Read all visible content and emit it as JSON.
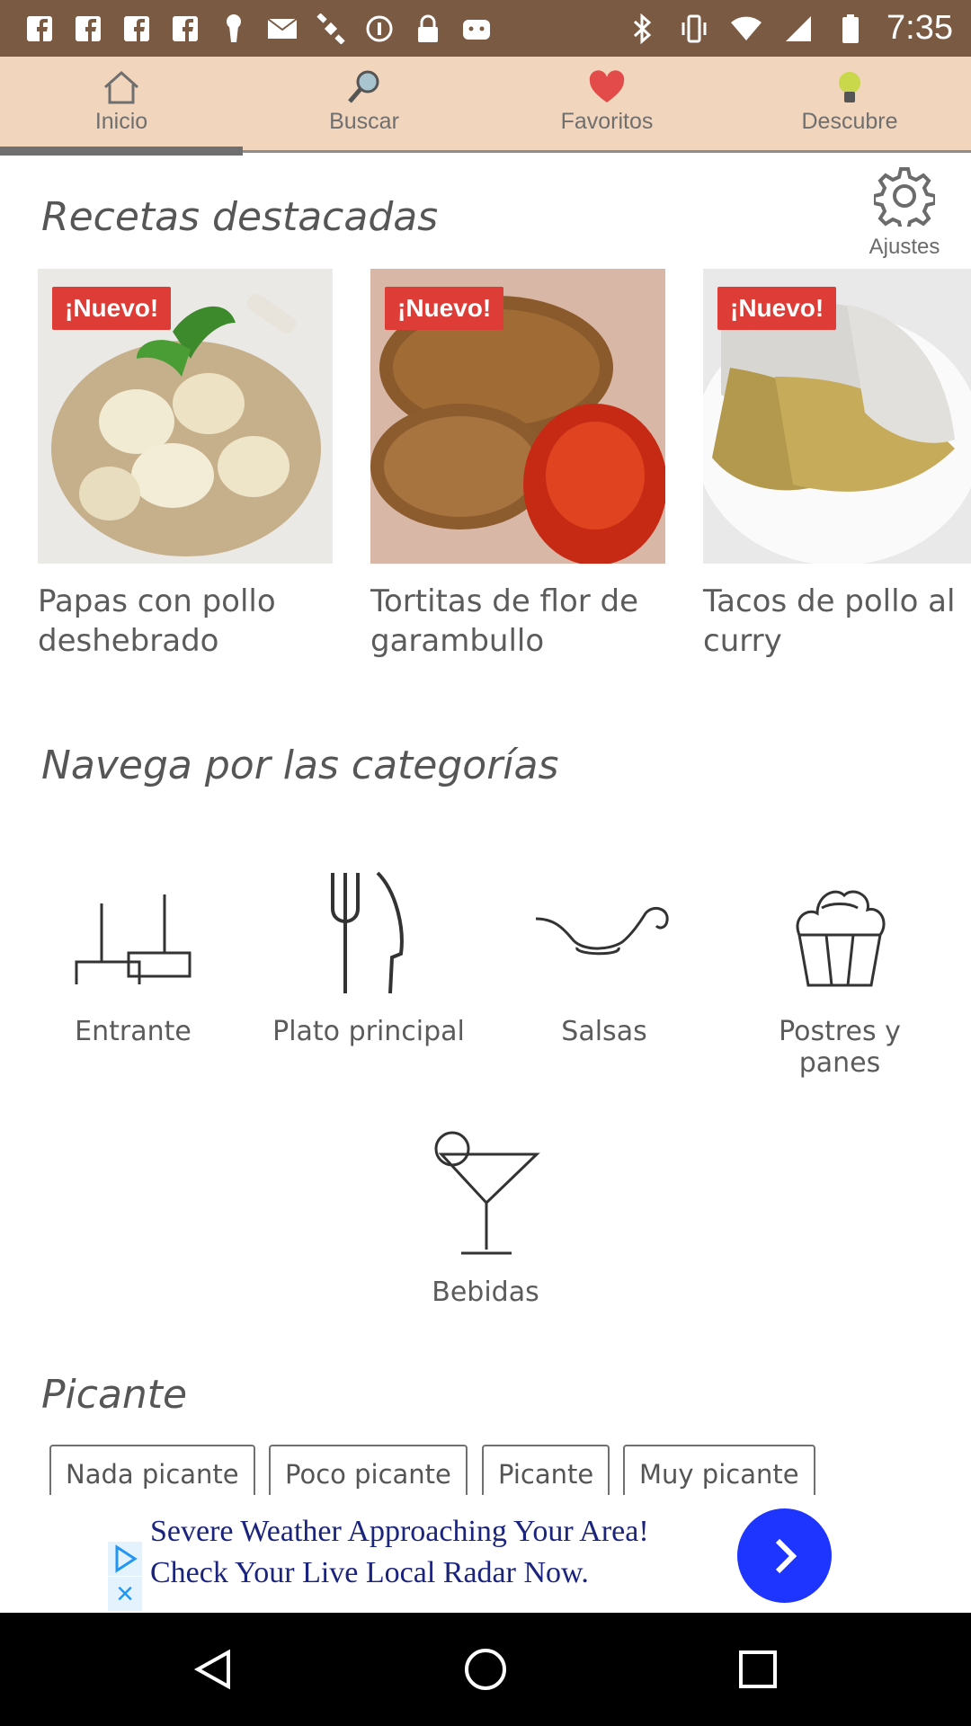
{
  "status_bar": {
    "time": "7:35"
  },
  "tabs": [
    {
      "label": "Inicio",
      "icon": "home-icon",
      "active": true
    },
    {
      "label": "Buscar",
      "icon": "search-icon",
      "active": false
    },
    {
      "label": "Favoritos",
      "icon": "heart-icon",
      "active": false
    },
    {
      "label": "Descubre",
      "icon": "lightbulb-icon",
      "active": false
    }
  ],
  "featured": {
    "title": "Recetas destacadas",
    "settings_label": "Ajustes",
    "recipes": [
      {
        "badge": "¡Nuevo!",
        "title": "Papas con pollo deshebrado"
      },
      {
        "badge": "¡Nuevo!",
        "title": "Tortitas de flor de garambullo"
      },
      {
        "badge": "¡Nuevo!",
        "title": "Tacos de pollo al curry"
      }
    ]
  },
  "categories": {
    "title": "Navega por las categorías",
    "items": [
      {
        "label": "Entrante",
        "icon": "spatula-icon"
      },
      {
        "label": "Plato principal",
        "icon": "fork-knife-icon"
      },
      {
        "label": "Salsas",
        "icon": "gravy-boat-icon"
      },
      {
        "label": "Postres y panes",
        "icon": "cupcake-icon"
      },
      {
        "label": "Bebidas",
        "icon": "cocktail-icon"
      }
    ]
  },
  "spicy": {
    "title": "Picante",
    "chips": [
      "Nada picante",
      "Poco picante",
      "Picante",
      "Muy picante"
    ]
  },
  "ad": {
    "line1": "Severe Weather Approaching Your Area!",
    "line2": "Check Your Live Local Radar Now."
  },
  "colors": {
    "status_bar": "#7a5a43",
    "tab_bar": "#f2d5bd",
    "badge": "#dd3c37",
    "ad_button": "#1e35ff"
  }
}
